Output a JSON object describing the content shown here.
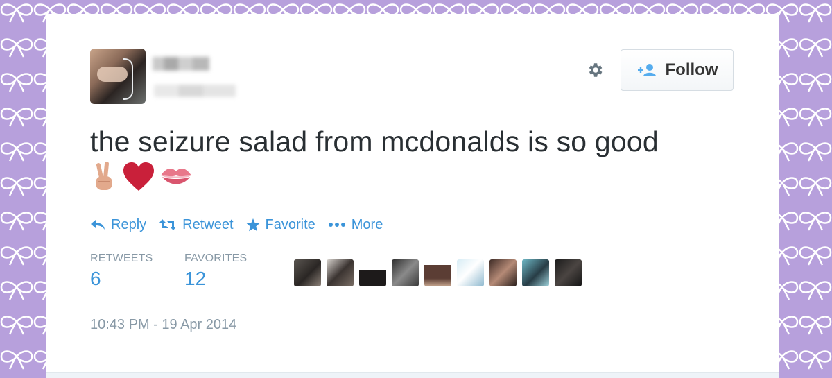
{
  "tweet": {
    "text": "the seizure salad from mcdonalds is so good",
    "emojis": [
      "victory-hand",
      "red-heart",
      "kiss-mark"
    ],
    "timestamp": "10:43 PM - 19 Apr 2014"
  },
  "header": {
    "follow_label": "Follow"
  },
  "actions": {
    "reply": "Reply",
    "retweet": "Retweet",
    "favorite": "Favorite",
    "more": "More"
  },
  "stats": {
    "retweets_label": "RETWEETS",
    "retweets_value": "6",
    "favorites_label": "FAVORITES",
    "favorites_value": "12"
  },
  "colors": {
    "background": "#b7a0dc",
    "link": "#3b94d9",
    "text": "#292f33",
    "muted": "#8899a6",
    "heart": "#c9203a"
  }
}
